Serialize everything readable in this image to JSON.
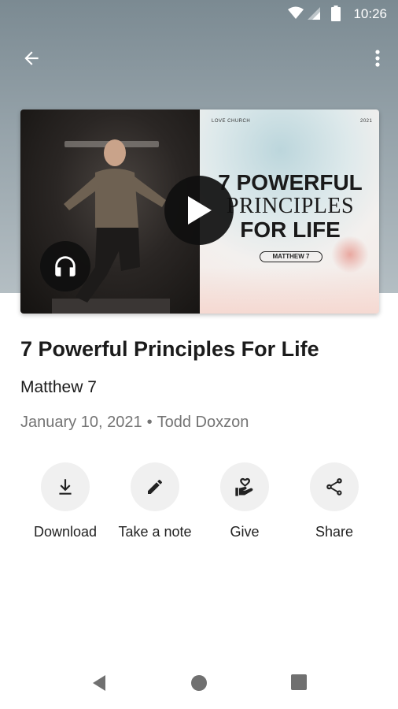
{
  "status_bar": {
    "time": "10:26"
  },
  "toolbar": {
    "back_icon": "arrow-left-icon",
    "more_icon": "more-vert-icon"
  },
  "thumbnail": {
    "label_left": "LOVE CHURCH",
    "label_right": "2021",
    "title_line1": "7 POWERFUL",
    "title_line2": "PRINCIPLES",
    "title_line3": "FOR LIFE",
    "pill": "MATTHEW 7",
    "play_icon": "play-icon",
    "audio_icon": "headphones-icon"
  },
  "sermon": {
    "title": "7 Powerful Principles For Life",
    "subtitle": "Matthew 7",
    "date": "January 10, 2021",
    "separator": "•",
    "speaker": "Todd Doxzon"
  },
  "actions": [
    {
      "label": "Download",
      "icon": "download-icon"
    },
    {
      "label": "Take a note",
      "icon": "pencil-icon"
    },
    {
      "label": "Give",
      "icon": "heart-hand-icon"
    },
    {
      "label": "Share",
      "icon": "share-icon"
    }
  ],
  "nav_bar": {
    "back": "back-triangle-icon",
    "home": "home-circle-icon",
    "recents": "recents-square-icon"
  },
  "colors": {
    "hero_top": "#7b8a92",
    "play_bg": "#0f0f0f",
    "meta_text": "#747474",
    "action_bg": "#f0f0f0"
  }
}
